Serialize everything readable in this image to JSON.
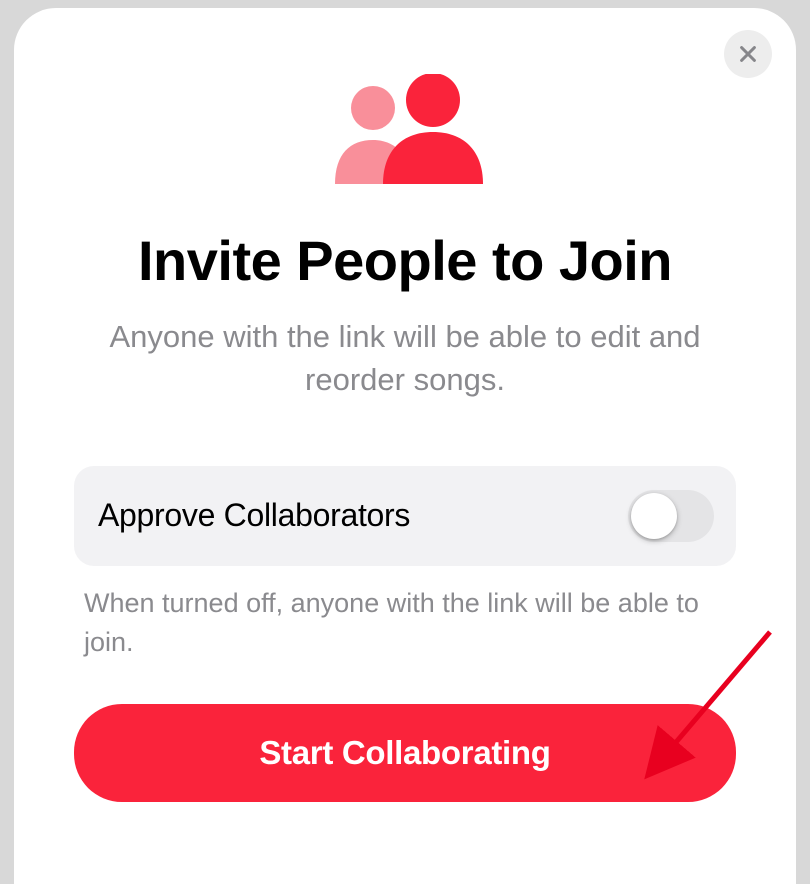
{
  "modal": {
    "title": "Invite People to Join",
    "subtitle": "Anyone with the link will be able to edit and reorder songs.",
    "option": {
      "label": "Approve Collaborators",
      "helper": "When turned off, anyone with the link will be able to join.",
      "enabled": false
    },
    "primary_button_label": "Start Collaborating"
  },
  "colors": {
    "accent": "#fa233b",
    "accent_light": "#f98f9a"
  }
}
